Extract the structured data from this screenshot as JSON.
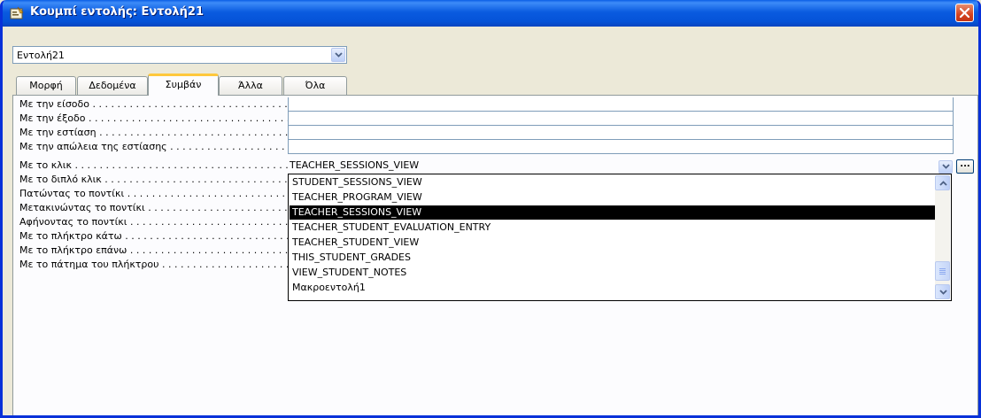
{
  "window": {
    "title": "Κουμπί εντολής: Εντολή21",
    "close_label": "X"
  },
  "object_selector": {
    "value": "Εντολή21"
  },
  "tabs": [
    {
      "label": "Μορφή",
      "active": false
    },
    {
      "label": "Δεδομένα",
      "active": false
    },
    {
      "label": "Συμβάν",
      "active": true
    },
    {
      "label": "Άλλα",
      "active": false
    },
    {
      "label": "Όλα",
      "active": false
    }
  ],
  "properties": [
    {
      "label": "Με την είσοδο",
      "value": ""
    },
    {
      "label": "Με την έξοδο",
      "value": ""
    },
    {
      "label": "Με την εστίαση",
      "value": ""
    },
    {
      "label": "Με την απώλεια της εστίασης",
      "value": ""
    },
    {
      "label": "Με το κλικ",
      "value": "TEACHER_SESSIONS_VIEW"
    },
    {
      "label": "Με το διπλό κλικ",
      "value": ""
    },
    {
      "label": "Πατώντας το ποντίκι",
      "value": ""
    },
    {
      "label": "Μετακινώντας το ποντίκι",
      "value": ""
    },
    {
      "label": "Αφήνοντας το ποντίκι",
      "value": ""
    },
    {
      "label": "Με το πλήκτρο κάτω",
      "value": ""
    },
    {
      "label": "Με το πλήκτρο επάνω",
      "value": ""
    },
    {
      "label": "Με το πάτημα του πλήκτρου",
      "value": ""
    }
  ],
  "builder_button_label": "...",
  "dropdown": {
    "items": [
      "STUDENT_SESSIONS_VIEW",
      "TEACHER_PROGRAM_VIEW",
      "TEACHER_SESSIONS_VIEW",
      "TEACHER_STUDENT_EVALUATION_ENTRY",
      "TEACHER_STUDENT_VIEW",
      "THIS_STUDENT_GRADES",
      "VIEW_STUDENT_NOTES",
      "Μακροεντολή1"
    ],
    "selected": "TEACHER_SESSIONS_VIEW"
  },
  "colors": {
    "titlebar": "#0553d8",
    "selection": "#000000",
    "tab_highlight": "#ffc83c",
    "close_button": "#d4431e"
  }
}
